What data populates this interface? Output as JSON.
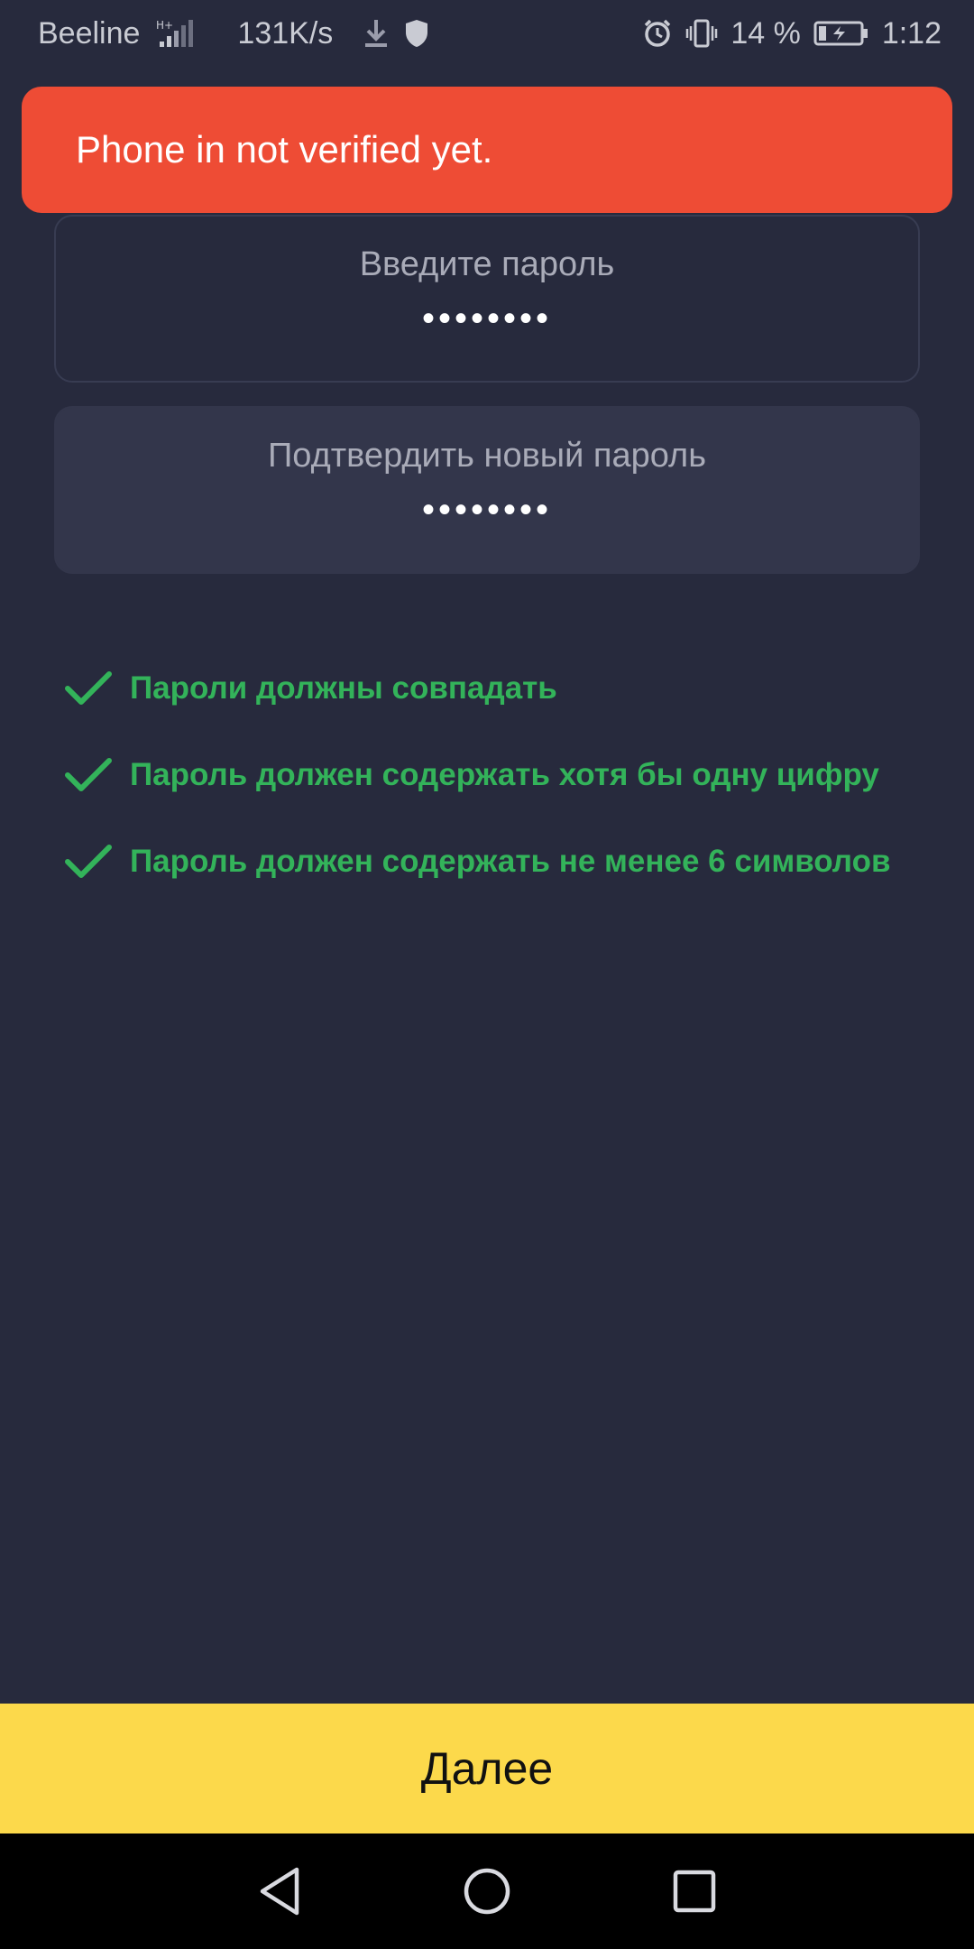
{
  "status_bar": {
    "carrier": "Beeline",
    "network_type": "H+",
    "speed": "131K/s",
    "battery_percent": "14 %",
    "time": "1:12",
    "icons": [
      "signal-icon",
      "download-icon",
      "shield-icon",
      "alarm-icon",
      "vibrate-icon",
      "battery-charging-icon"
    ]
  },
  "toast": {
    "message": "Phone in not verified yet.",
    "color": "#ee4c35"
  },
  "fields": {
    "password": {
      "label": "Введите пароль",
      "value": "••••••••"
    },
    "confirm_password": {
      "label": "Подтвердить новый пароль",
      "value": "••••••••"
    }
  },
  "rules": [
    {
      "text": "Пароли должны совпадать",
      "status": "passed"
    },
    {
      "text": "Пароль должен содержать хотя бы одну цифру",
      "status": "passed"
    },
    {
      "text": "Пароль должен содержать не менее 6 символов",
      "status": "passed"
    }
  ],
  "next_button": {
    "label": "Далее",
    "color": "#fcd94b"
  },
  "nav_bar": {
    "icons": [
      "back-icon",
      "home-icon",
      "recents-icon"
    ]
  },
  "colors": {
    "background": "#272a3d",
    "success": "#33b35a"
  }
}
